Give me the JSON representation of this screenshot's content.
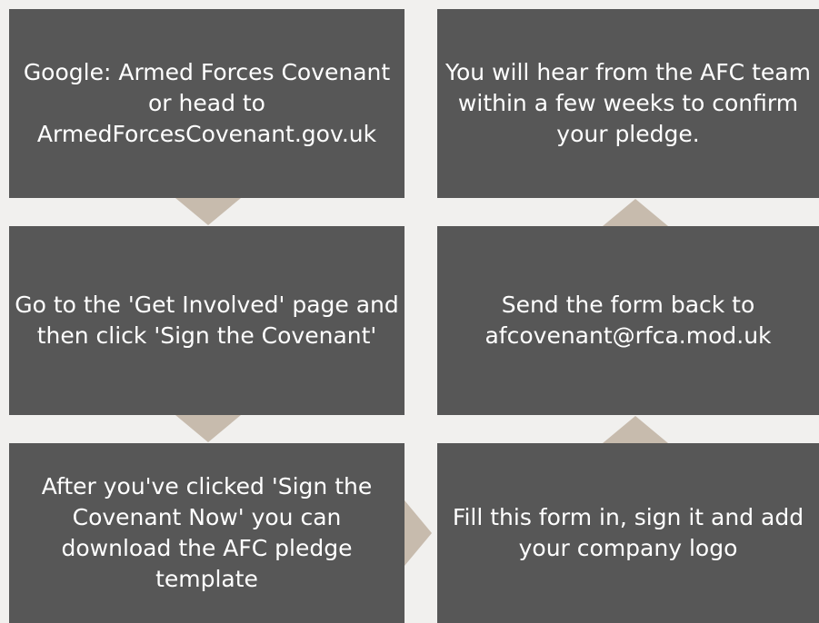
{
  "steps": {
    "step1": "Google: Armed Forces Covenant or head to ArmedForcesCovenant.gov.uk",
    "step2": "Go to the 'Get Involved' page and then click 'Sign the Covenant'",
    "step3": "After you've clicked 'Sign the Covenant Now' you can download the AFC pledge template",
    "step4": "Fill this form in, sign it and add your company logo",
    "step5": "Send the form back to afcovenant@rfca.mod.uk",
    "step6": "You will hear from the AFC team within a few weeks to confirm your pledge."
  },
  "colors": {
    "box": "#575757",
    "arrow": "#c7bbad",
    "background": "#f1f0ee",
    "text": "#ffffff"
  }
}
